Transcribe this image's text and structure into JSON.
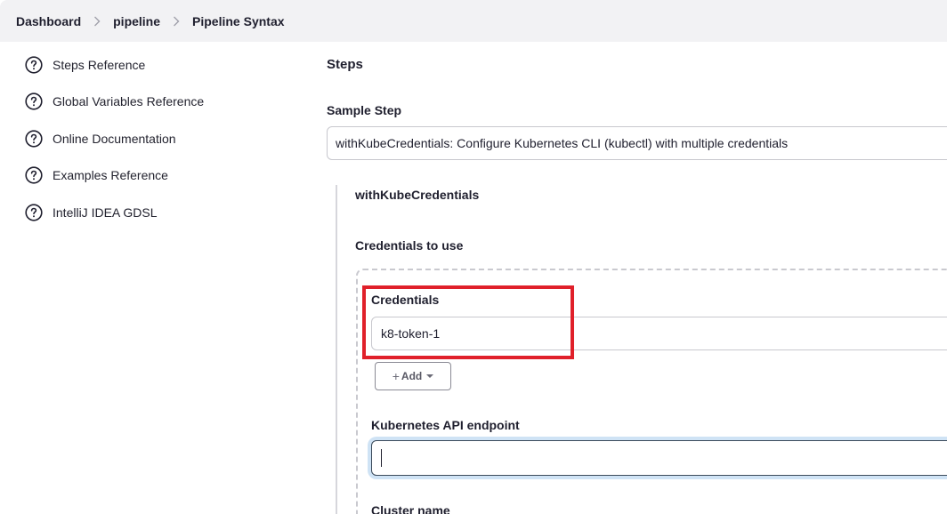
{
  "breadcrumb": {
    "items": [
      "Dashboard",
      "pipeline",
      "Pipeline Syntax"
    ]
  },
  "sidebar": {
    "items": [
      {
        "label": "Steps Reference",
        "icon": "help-circle-icon"
      },
      {
        "label": "Global Variables Reference",
        "icon": "help-circle-icon"
      },
      {
        "label": "Online Documentation",
        "icon": "help-circle-icon"
      },
      {
        "label": "Examples Reference",
        "icon": "help-circle-icon"
      },
      {
        "label": "IntelliJ IDEA GDSL",
        "icon": "help-circle-icon"
      }
    ]
  },
  "main": {
    "section_title": "Steps",
    "sample_step_label": "Sample Step",
    "sample_step_value": "withKubeCredentials: Configure Kubernetes CLI (kubectl) with multiple credentials",
    "step_name": "withKubeCredentials",
    "credentials_to_use_label": "Credentials to use",
    "credentials_label": "Credentials",
    "credentials_value": "k8-token-1",
    "add_button_label": "Add",
    "api_endpoint_label": "Kubernetes API endpoint",
    "api_endpoint_value": "",
    "cluster_name_label": "Cluster name"
  },
  "colors": {
    "highlight": "#e0202a",
    "focus_ring": "#cfe3f5",
    "breadcrumb_bg": "#f2f2f4"
  }
}
